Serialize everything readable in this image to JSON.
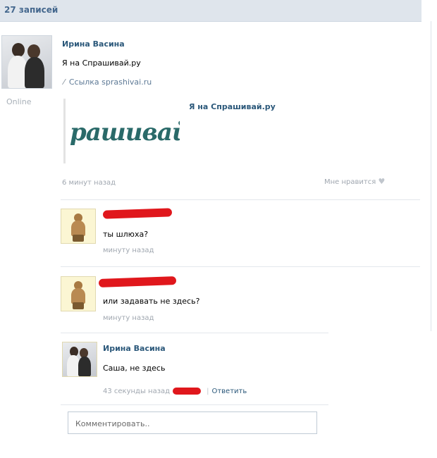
{
  "header": {
    "entries_count": "27 записей"
  },
  "post": {
    "author": "Ирина Васина",
    "status": "Online",
    "text": "Я на Спрашивай.ру",
    "link_label": "Ссылка sprashivai.ru",
    "snippet_logo_text": "рашивай.р",
    "snippet_title": "Я на Спрашивай.ру",
    "time": "6 минут назад",
    "like_label": "Мне нравится"
  },
  "comments": [
    {
      "text": "ты шлюха?",
      "time": "минуту назад"
    },
    {
      "text": "или задавать не здесь?",
      "time": "минуту назад"
    },
    {
      "author": "Ирина Васина",
      "text": "Саша, не здесь",
      "time": "43 секунды назад",
      "reply_label": "Ответить"
    }
  ],
  "comment_input": {
    "placeholder": "Комментировать.."
  },
  "colors": {
    "link": "#2b587a",
    "meta": "#a0a7b0",
    "redaction": "#e0171c",
    "header_bg": "#dfe5ec"
  }
}
